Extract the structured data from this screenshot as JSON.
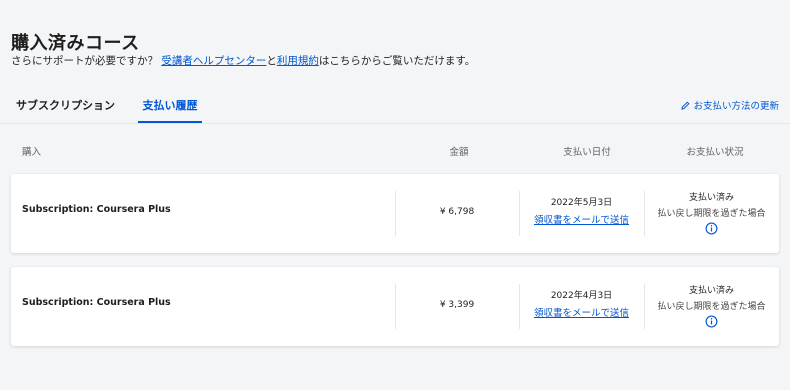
{
  "header": {
    "title": "購入済みコース",
    "help_prefix": "さらにサポートが必要ですか？",
    "help_center_link": "受講者ヘルプセンター",
    "help_and": "と",
    "terms_link": "利用規約",
    "help_suffix": "はこちらからご覧いただけます。"
  },
  "tabs": {
    "subscription": "サブスクリプション",
    "payment_history": "支払い履歴",
    "active": "payment_history",
    "update_payment_link": "お支払い方法の更新"
  },
  "columns": {
    "purchase": "購入",
    "amount": "金額",
    "payment_date": "支払い日付",
    "payment_status": "お支払い状況"
  },
  "rows": [
    {
      "name": "Subscription: Coursera Plus",
      "amount": "¥ 6,798",
      "date": "2022年5月3日",
      "receipt_link": "領収書をメールで送信",
      "status": "支払い済み",
      "refund_note": "払い戻し期限を過ぎた場合"
    },
    {
      "name": "Subscription: Coursera Plus",
      "amount": "¥ 3,399",
      "date": "2022年4月3日",
      "receipt_link": "領収書をメールで送信",
      "status": "支払い済み",
      "refund_note": "払い戻し期限を過ぎた場合"
    }
  ],
  "icons": {
    "edit": "pencil-icon",
    "info": "info-icon"
  },
  "colors": {
    "accent": "#0056d2",
    "background": "#f4f5f7",
    "card": "#ffffff"
  }
}
